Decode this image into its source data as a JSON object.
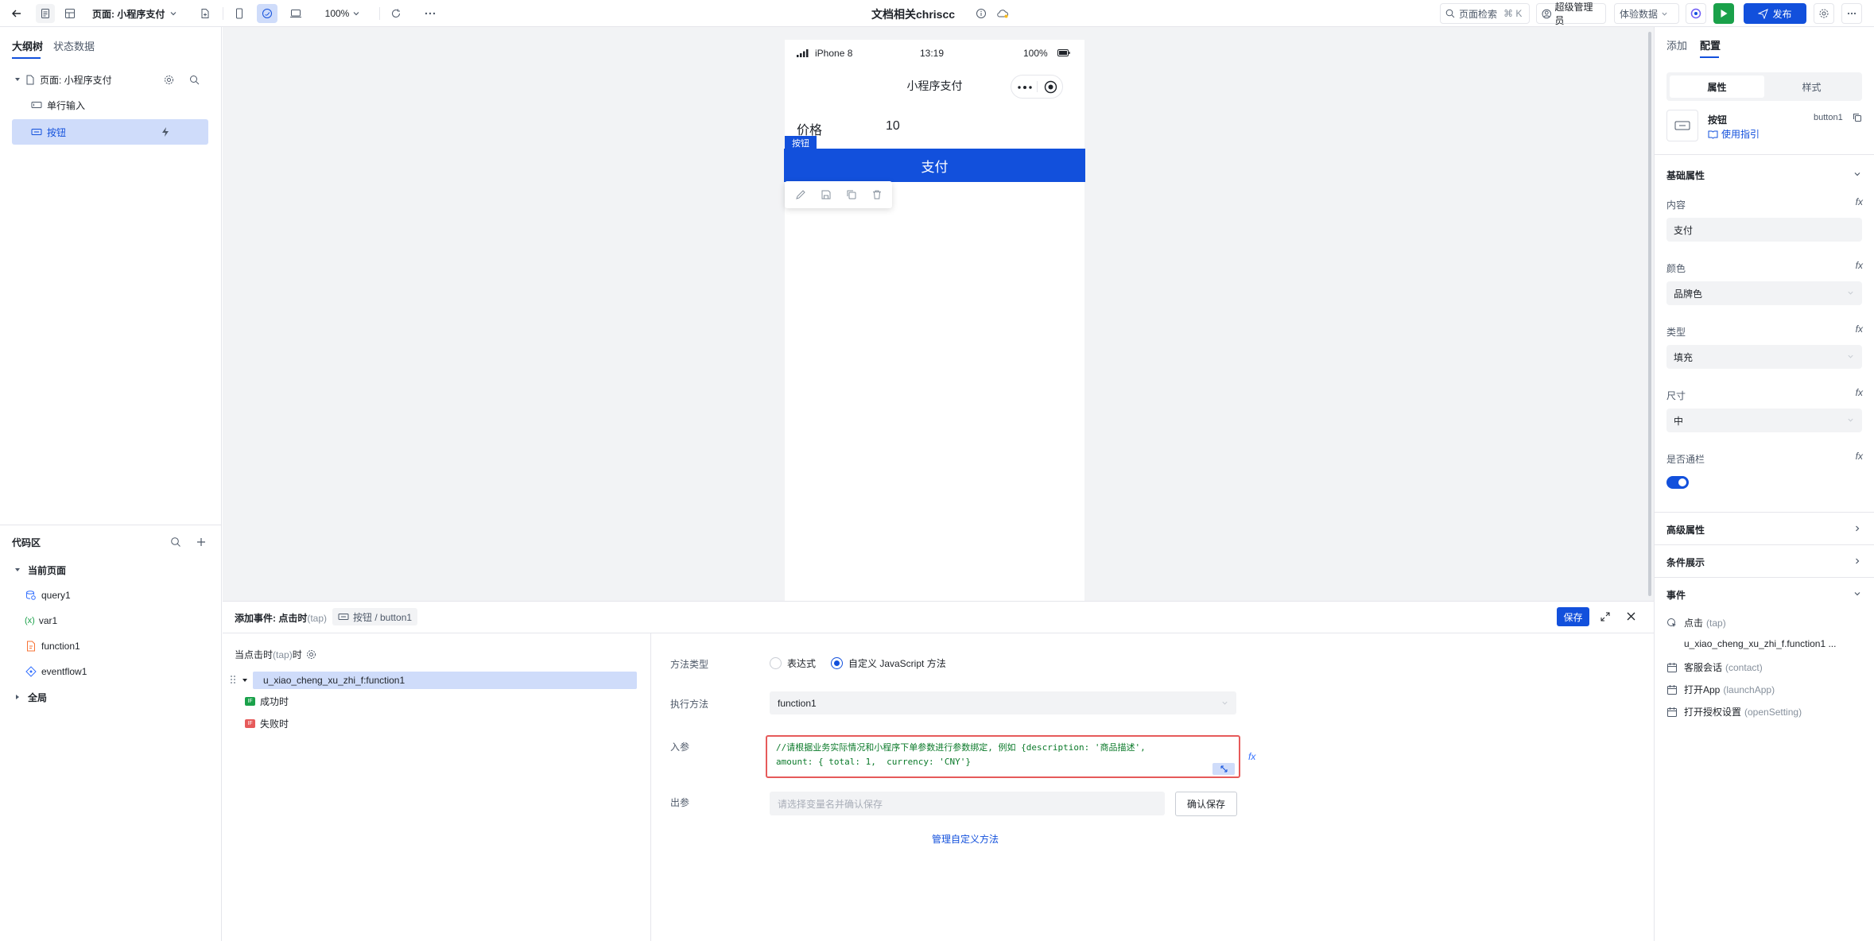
{
  "topbar": {
    "page_selector": "页面: 小程序支付",
    "zoom": "100%",
    "title": "文档相关chriscc",
    "search_label": "页面检索",
    "search_shortcut": "⌘ K",
    "role_label": "超级管理员",
    "data_label": "体验数据",
    "publish_label": "发布"
  },
  "left": {
    "tabs": [
      "大纲树",
      "状态数据"
    ],
    "tree": {
      "page": "页面: 小程序支付",
      "items": [
        "单行输入",
        "按钮"
      ]
    },
    "code_area": {
      "title": "代码区",
      "current_page": "当前页面",
      "items": [
        "query1",
        "var1",
        "function1",
        "eventflow1"
      ],
      "global": "全局"
    }
  },
  "phone": {
    "carrier": "iPhone 8",
    "time": "13:19",
    "battery": "100%",
    "nav_title": "小程序支付",
    "price_label": "价格",
    "price_value": "10",
    "button_tag": "按钮",
    "button_label": "支付"
  },
  "event_panel": {
    "title": "添加事件: 点击时",
    "title_suffix": "(tap)",
    "component_path": "按钮 / button1",
    "save": "保存",
    "trigger": "当点击时",
    "trigger_suffix": "(tap)",
    "trigger_end": "时",
    "action_name": "u_xiao_cheng_xu_zhi_f:function1",
    "success": "成功时",
    "fail": "失败时",
    "method_type_label": "方法类型",
    "radio_expression": "表达式",
    "radio_custom": "自定义 JavaScript 方法",
    "exec_label": "执行方法",
    "exec_value": "function1",
    "input_label": "入参",
    "input_code_line1": "//请根据业务实际情况和小程序下单参数进行参数绑定, 例如 {description: '商品描述',",
    "input_code_line2": "amount: { total: 1,  currency: 'CNY'}",
    "output_label": "出参",
    "output_placeholder": "请选择变量名并确认保存",
    "confirm_save": "确认保存",
    "manage_link": "管理自定义方法"
  },
  "right": {
    "tabs": [
      "添加",
      "配置"
    ],
    "seg": [
      "属性",
      "样式"
    ],
    "component_name": "按钮",
    "component_id": "button1",
    "guide_link": "使用指引",
    "basic_title": "基础属性",
    "content_label": "内容",
    "content_value": "支付",
    "color_label": "颜色",
    "color_value": "品牌色",
    "type_label": "类型",
    "type_value": "填充",
    "size_label": "尺寸",
    "size_value": "中",
    "full_label": "是否通栏",
    "advanced_title": "高级属性",
    "condition_title": "条件展示",
    "events_title": "事件",
    "events": [
      {
        "label": "点击",
        "suffix": "(tap)"
      },
      {
        "label": "客服会话",
        "suffix": "(contact)"
      },
      {
        "label": "打开App",
        "suffix": "(launchApp)"
      },
      {
        "label": "打开授权设置",
        "suffix": "(openSetting)"
      }
    ],
    "tap_action": "u_xiao_cheng_xu_zhi_f.function1 ..."
  },
  "colors": {
    "brand": "#1250dc",
    "selected_row": "#cfdcfa",
    "canvas_bg": "#f2f3f5",
    "run_green": "#1aa14a",
    "error_border": "#e65a5a"
  }
}
